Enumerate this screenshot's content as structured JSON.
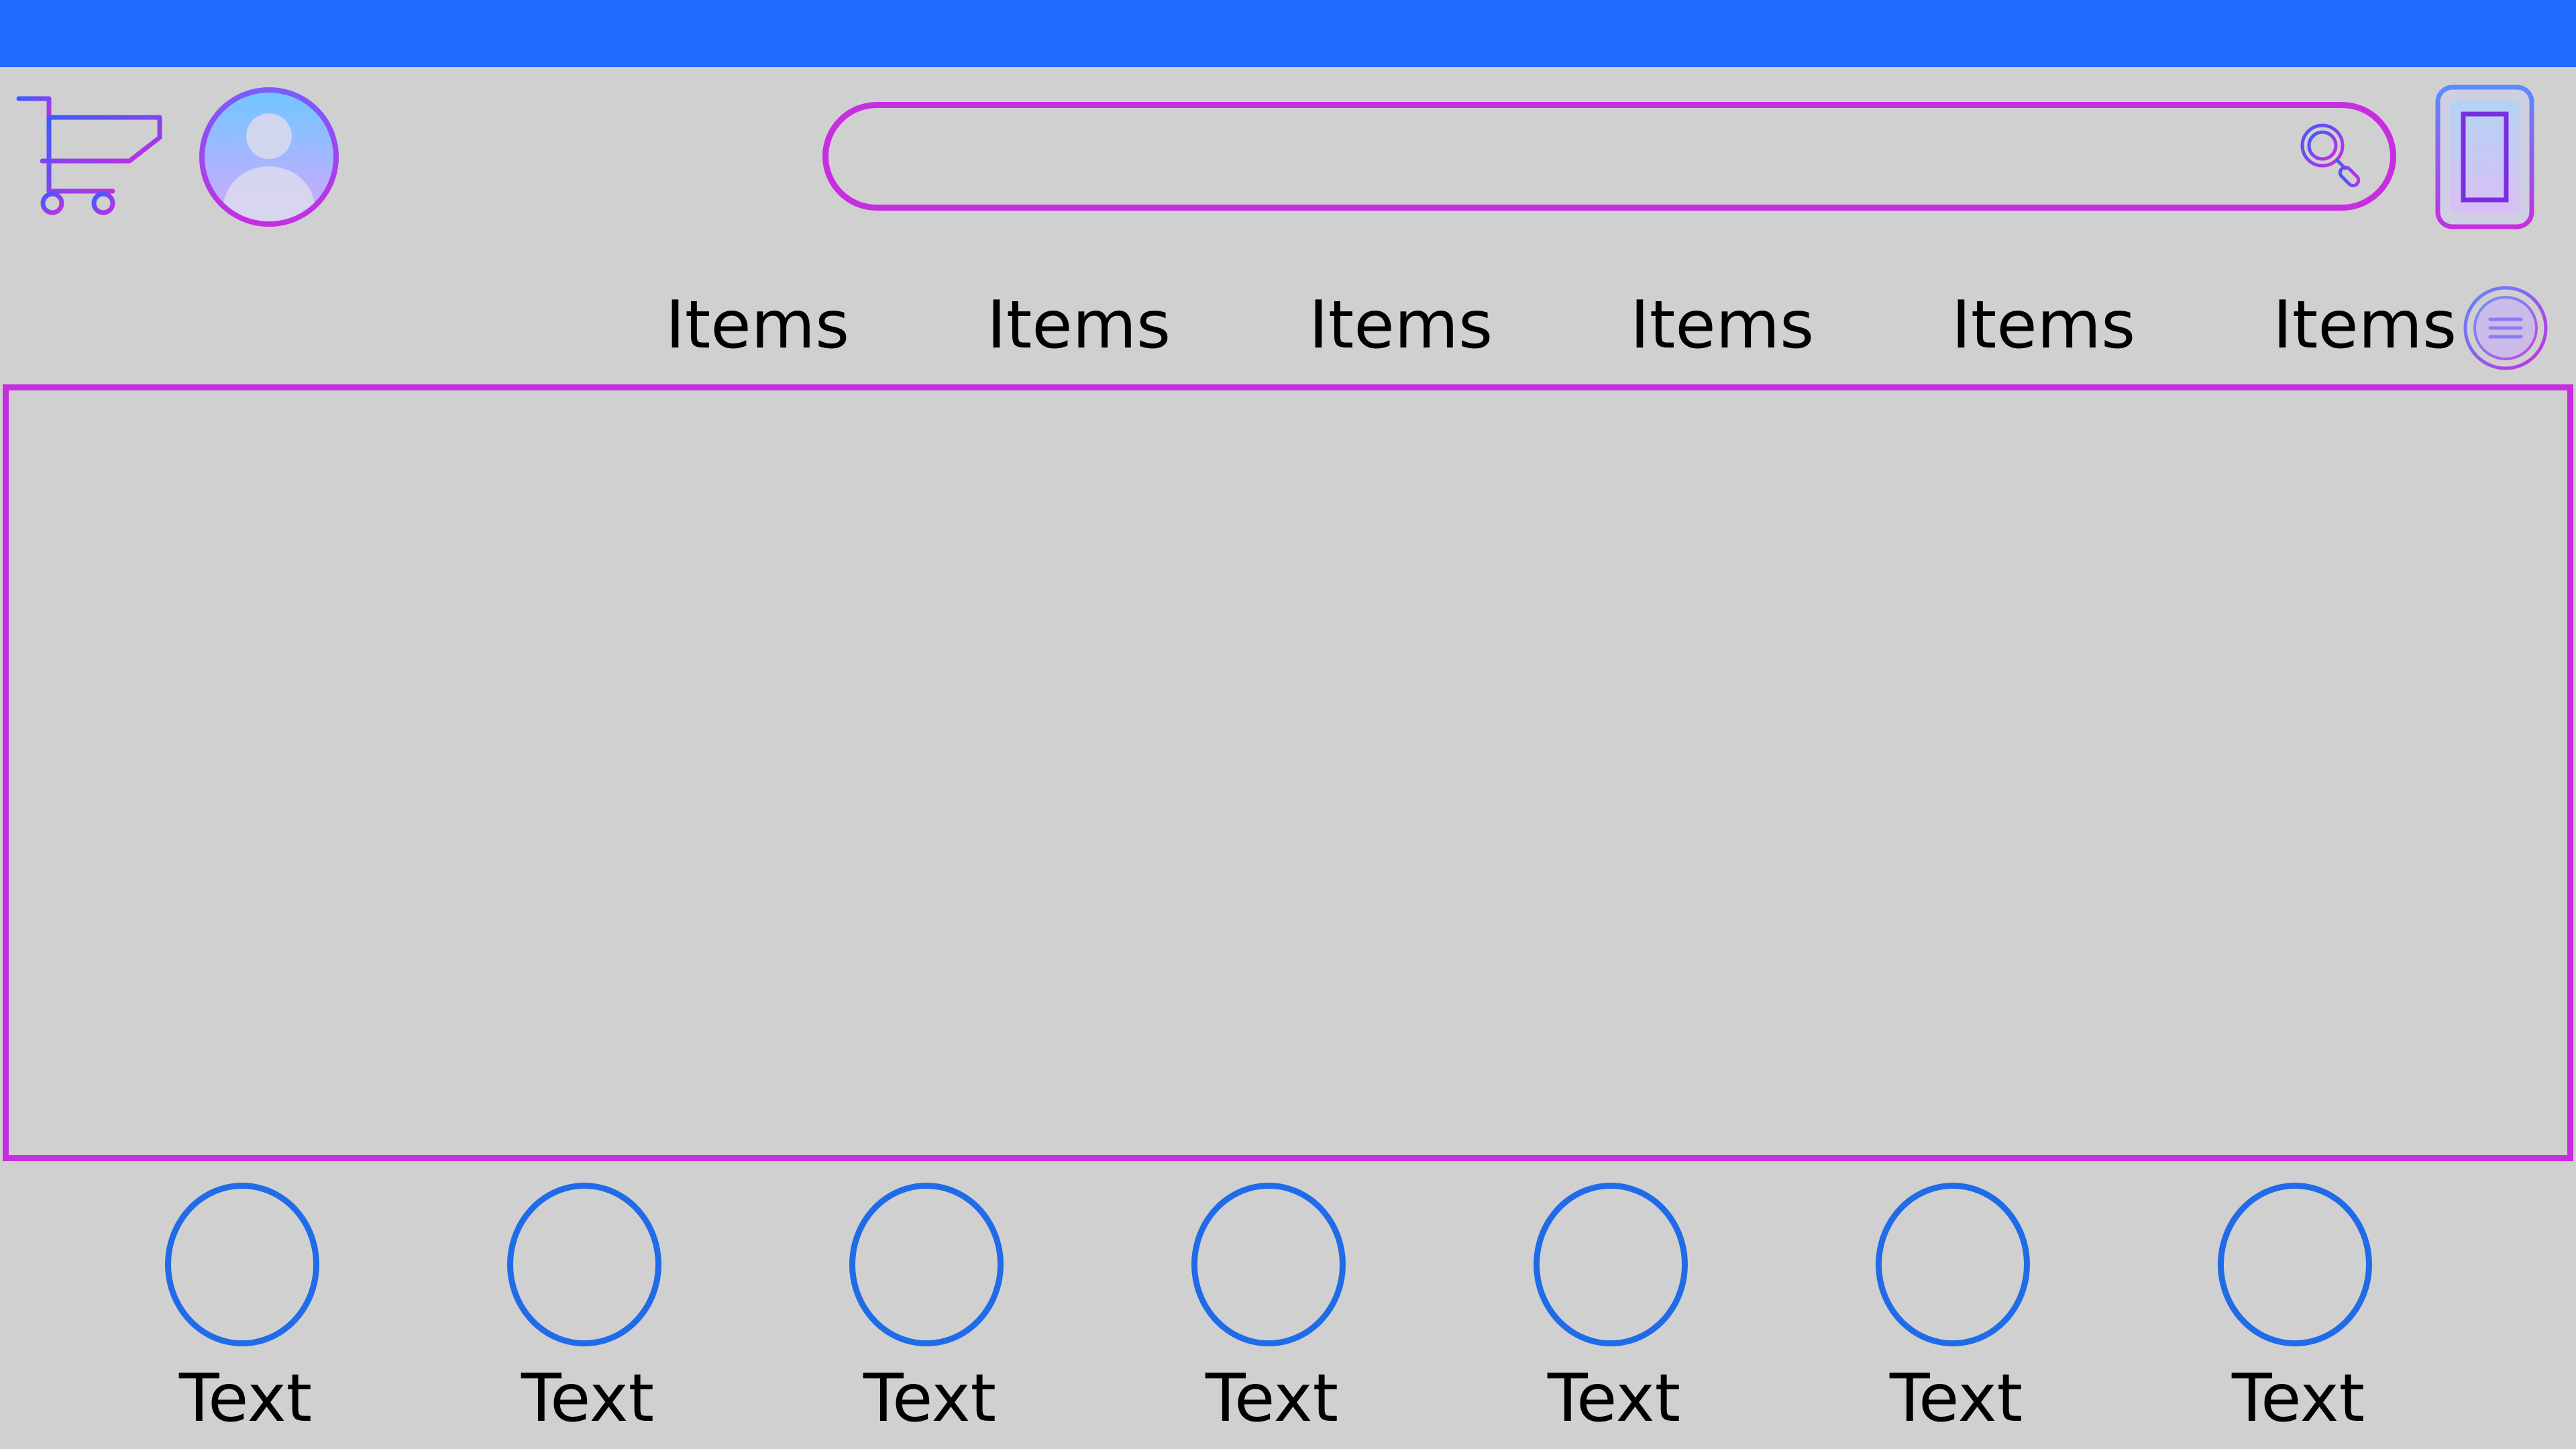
{
  "colors": {
    "topbar": "#1f6bff",
    "accent_purple": "#c62ee0",
    "accent_blue": "#1f6be8",
    "background": "#d0d0d0"
  },
  "header": {
    "cart_icon": "cart-icon",
    "avatar_icon": "user-avatar-icon",
    "search": {
      "placeholder": "",
      "value": "",
      "icon": "search-icon"
    },
    "device_icon": "phone-icon",
    "menu_icon": "menu-icon"
  },
  "nav": {
    "items": [
      {
        "label": "Items"
      },
      {
        "label": "Items"
      },
      {
        "label": "Items"
      },
      {
        "label": "Items"
      },
      {
        "label": "Items"
      },
      {
        "label": "Items"
      }
    ]
  },
  "categories": [
    {
      "label": "Text"
    },
    {
      "label": "Text"
    },
    {
      "label": "Text"
    },
    {
      "label": "Text"
    },
    {
      "label": "Text"
    },
    {
      "label": "Text"
    },
    {
      "label": "Text"
    }
  ]
}
